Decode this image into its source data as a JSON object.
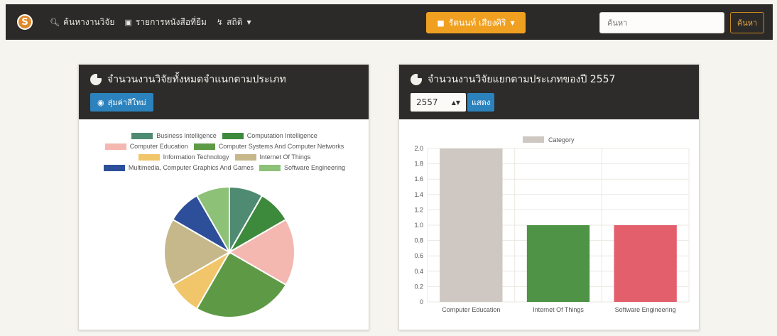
{
  "navbar": {
    "logo_letter": "S",
    "items": [
      {
        "label": "ค้นหางานวิจัย",
        "icon": "search-icon"
      },
      {
        "label": "รายการหนังสือที่ยืม",
        "icon": "book-icon"
      },
      {
        "label": "สถิติ",
        "icon": "line-chart-icon"
      }
    ],
    "user_label": "รัตนนท์ เสียงศิริ",
    "search_placeholder": "ค้นหา",
    "search_button": "ค้นหา",
    "accent_color": "#f0a020"
  },
  "left_panel": {
    "title": "จำนวนงานวิจัยทั้งหมดจำแนกตามประเภท",
    "button_label": "สุ่มค่าสีใหม่",
    "button_icon": "palette-icon"
  },
  "right_panel": {
    "title": "จำนวนงานวิจัยแยกตามประเภทของปี 2557",
    "year_selected": "2557",
    "show_button": "แสดง"
  },
  "chart_data": [
    {
      "type": "pie",
      "legend_position": "top",
      "categories": [
        "Business Intelligence",
        "Computation Intelligence",
        "Computer Education",
        "Computer Systems And Computer Networks",
        "Information Technology",
        "Internet Of Things",
        "Multimedia, Computer Graphics And Games",
        "Software Engineering"
      ],
      "values": [
        1,
        1,
        2,
        3,
        1,
        2,
        1,
        1
      ],
      "colors": [
        "#4f8a72",
        "#3d8a3d",
        "#f4b8b0",
        "#5e9a46",
        "#f1c66a",
        "#c6b88a",
        "#2d4f9a",
        "#8cc177"
      ]
    },
    {
      "type": "bar",
      "legend_position": "top",
      "series": [
        {
          "name": "Category",
          "values": [
            2.0,
            1.0,
            1.0
          ]
        }
      ],
      "categories": [
        "Computer Education",
        "Internet Of Things",
        "Software Engineering"
      ],
      "colors": [
        "#cfc8c2",
        "#4f9446",
        "#e35f6b"
      ],
      "legend_swatch_color": "#cfc8c2",
      "ylim": [
        0,
        2.0
      ],
      "ticks": [
        "0",
        "0.2",
        "0.4",
        "0.6",
        "0.8",
        "1.0",
        "1.2",
        "1.4",
        "1.6",
        "1.8",
        "2.0"
      ],
      "grid": true
    }
  ]
}
